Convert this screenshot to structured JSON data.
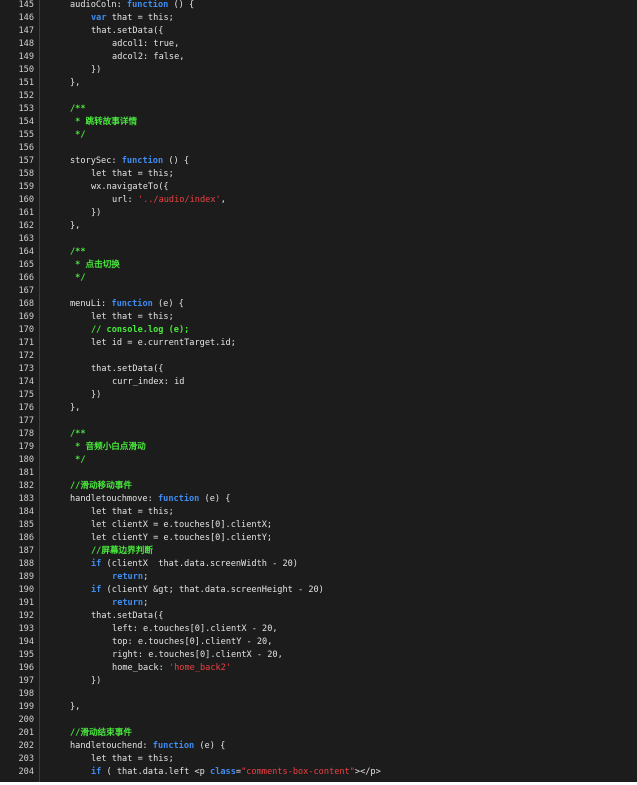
{
  "editor": {
    "colors": {
      "background": "#1c1c1c",
      "text": "#e3e3e3",
      "keyword": "#3e8cf0",
      "comment": "#49e83d",
      "string": "#ee4040",
      "line_number": "#cfcfcf"
    },
    "lines": [
      {
        "num": "145",
        "indent": 0,
        "tokens": [
          {
            "t": "audioColn: ",
            "c": "plain"
          },
          {
            "t": "function",
            "c": "kw"
          },
          {
            "t": " () {",
            "c": "plain"
          }
        ]
      },
      {
        "num": "146",
        "indent": 2,
        "tokens": [
          {
            "t": "var",
            "c": "kw"
          },
          {
            "t": " that = this;",
            "c": "plain"
          }
        ]
      },
      {
        "num": "147",
        "indent": 2,
        "tokens": [
          {
            "t": "that.setData({",
            "c": "plain"
          }
        ]
      },
      {
        "num": "148",
        "indent": 4,
        "tokens": [
          {
            "t": "adcol1: true,",
            "c": "plain"
          }
        ]
      },
      {
        "num": "149",
        "indent": 4,
        "tokens": [
          {
            "t": "adcol2: false,",
            "c": "plain"
          }
        ]
      },
      {
        "num": "150",
        "indent": 2,
        "tokens": [
          {
            "t": "})",
            "c": "plain"
          }
        ]
      },
      {
        "num": "151",
        "indent": 0,
        "tokens": [
          {
            "t": "},",
            "c": "plain"
          }
        ]
      },
      {
        "num": "152",
        "indent": 0,
        "tokens": []
      },
      {
        "num": "153",
        "indent": 0,
        "tokens": [
          {
            "t": "/**",
            "c": "cm"
          }
        ]
      },
      {
        "num": "154",
        "indent": 0,
        "tokens": [
          {
            "t": " * 跳转故事详情",
            "c": "cm"
          }
        ]
      },
      {
        "num": "155",
        "indent": 0,
        "tokens": [
          {
            "t": " */",
            "c": "cm"
          }
        ]
      },
      {
        "num": "156",
        "indent": 0,
        "tokens": []
      },
      {
        "num": "157",
        "indent": 0,
        "tokens": [
          {
            "t": "storySec: ",
            "c": "plain"
          },
          {
            "t": "function",
            "c": "kw"
          },
          {
            "t": " () {",
            "c": "plain"
          }
        ]
      },
      {
        "num": "158",
        "indent": 2,
        "tokens": [
          {
            "t": "let that = this;",
            "c": "plain"
          }
        ]
      },
      {
        "num": "159",
        "indent": 2,
        "tokens": [
          {
            "t": "wx.navigateTo({",
            "c": "plain"
          }
        ]
      },
      {
        "num": "160",
        "indent": 4,
        "tokens": [
          {
            "t": "url: ",
            "c": "plain"
          },
          {
            "t": "'../audio/index'",
            "c": "str"
          },
          {
            "t": ",",
            "c": "plain"
          }
        ]
      },
      {
        "num": "161",
        "indent": 2,
        "tokens": [
          {
            "t": "})",
            "c": "plain"
          }
        ]
      },
      {
        "num": "162",
        "indent": 0,
        "tokens": [
          {
            "t": "},",
            "c": "plain"
          }
        ]
      },
      {
        "num": "163",
        "indent": 0,
        "tokens": []
      },
      {
        "num": "164",
        "indent": 0,
        "tokens": [
          {
            "t": "/**",
            "c": "cm"
          }
        ]
      },
      {
        "num": "165",
        "indent": 0,
        "tokens": [
          {
            "t": " * 点击切换",
            "c": "cm"
          }
        ]
      },
      {
        "num": "166",
        "indent": 0,
        "tokens": [
          {
            "t": " */",
            "c": "cm"
          }
        ]
      },
      {
        "num": "167",
        "indent": 0,
        "tokens": []
      },
      {
        "num": "168",
        "indent": 0,
        "tokens": [
          {
            "t": "menuLi: ",
            "c": "plain"
          },
          {
            "t": "function",
            "c": "kw"
          },
          {
            "t": " (e) {",
            "c": "plain"
          }
        ]
      },
      {
        "num": "169",
        "indent": 2,
        "tokens": [
          {
            "t": "let that = this;",
            "c": "plain"
          }
        ]
      },
      {
        "num": "170",
        "indent": 2,
        "tokens": [
          {
            "t": "// console.log (e);",
            "c": "cm"
          }
        ]
      },
      {
        "num": "171",
        "indent": 2,
        "tokens": [
          {
            "t": "let id = e.currentTarget.id;",
            "c": "plain"
          }
        ]
      },
      {
        "num": "172",
        "indent": 0,
        "tokens": []
      },
      {
        "num": "173",
        "indent": 2,
        "tokens": [
          {
            "t": "that.setData({",
            "c": "plain"
          }
        ]
      },
      {
        "num": "174",
        "indent": 4,
        "tokens": [
          {
            "t": "curr_index: id",
            "c": "plain"
          }
        ]
      },
      {
        "num": "175",
        "indent": 2,
        "tokens": [
          {
            "t": "})",
            "c": "plain"
          }
        ]
      },
      {
        "num": "176",
        "indent": 0,
        "tokens": [
          {
            "t": "},",
            "c": "plain"
          }
        ]
      },
      {
        "num": "177",
        "indent": 0,
        "tokens": []
      },
      {
        "num": "178",
        "indent": 0,
        "tokens": [
          {
            "t": "/**",
            "c": "cm"
          }
        ]
      },
      {
        "num": "179",
        "indent": 0,
        "tokens": [
          {
            "t": " * 音频小白点滑动",
            "c": "cm"
          }
        ]
      },
      {
        "num": "180",
        "indent": 0,
        "tokens": [
          {
            "t": " */",
            "c": "cm"
          }
        ]
      },
      {
        "num": "181",
        "indent": 0,
        "tokens": []
      },
      {
        "num": "182",
        "indent": 0,
        "tokens": [
          {
            "t": "//滑动移动事件",
            "c": "cm"
          }
        ]
      },
      {
        "num": "183",
        "indent": 0,
        "tokens": [
          {
            "t": "handletouchmove: ",
            "c": "plain"
          },
          {
            "t": "function",
            "c": "kw"
          },
          {
            "t": " (e) {",
            "c": "plain"
          }
        ]
      },
      {
        "num": "184",
        "indent": 2,
        "tokens": [
          {
            "t": "let that = this;",
            "c": "plain"
          }
        ]
      },
      {
        "num": "185",
        "indent": 2,
        "tokens": [
          {
            "t": "let clientX = e.touches[0].clientX;",
            "c": "plain"
          }
        ]
      },
      {
        "num": "186",
        "indent": 2,
        "tokens": [
          {
            "t": "let clientY = e.touches[0].clientY;",
            "c": "plain"
          }
        ]
      },
      {
        "num": "187",
        "indent": 2,
        "tokens": [
          {
            "t": "//屏幕边界判断",
            "c": "cm"
          }
        ]
      },
      {
        "num": "188",
        "indent": 2,
        "tokens": [
          {
            "t": "if",
            "c": "kw"
          },
          {
            "t": " (clientX  that.data.screenWidth - 20)",
            "c": "plain"
          }
        ]
      },
      {
        "num": "189",
        "indent": 4,
        "tokens": [
          {
            "t": "return",
            "c": "kw"
          },
          {
            "t": ";",
            "c": "plain"
          }
        ]
      },
      {
        "num": "190",
        "indent": 2,
        "tokens": [
          {
            "t": "if",
            "c": "kw"
          },
          {
            "t": " (clientY &gt; that.data.screenHeight - 20)",
            "c": "plain"
          }
        ]
      },
      {
        "num": "191",
        "indent": 4,
        "tokens": [
          {
            "t": "return",
            "c": "kw"
          },
          {
            "t": ";",
            "c": "plain"
          }
        ]
      },
      {
        "num": "192",
        "indent": 2,
        "tokens": [
          {
            "t": "that.setData({",
            "c": "plain"
          }
        ]
      },
      {
        "num": "193",
        "indent": 4,
        "tokens": [
          {
            "t": "left: e.touches[0].clientX - 20,",
            "c": "plain"
          }
        ]
      },
      {
        "num": "194",
        "indent": 4,
        "tokens": [
          {
            "t": "top: e.touches[0].clientY - 20,",
            "c": "plain"
          }
        ]
      },
      {
        "num": "195",
        "indent": 4,
        "tokens": [
          {
            "t": "right: e.touches[0].clientX - 20,",
            "c": "plain"
          }
        ]
      },
      {
        "num": "196",
        "indent": 4,
        "tokens": [
          {
            "t": "home_back: ",
            "c": "plain"
          },
          {
            "t": "'home_back2'",
            "c": "str"
          }
        ]
      },
      {
        "num": "197",
        "indent": 2,
        "tokens": [
          {
            "t": "})",
            "c": "plain"
          }
        ]
      },
      {
        "num": "198",
        "indent": 0,
        "tokens": []
      },
      {
        "num": "199",
        "indent": 0,
        "tokens": [
          {
            "t": "},",
            "c": "plain"
          }
        ]
      },
      {
        "num": "200",
        "indent": 0,
        "tokens": []
      },
      {
        "num": "201",
        "indent": 0,
        "tokens": [
          {
            "t": "//滑动结束事件",
            "c": "cm"
          }
        ]
      },
      {
        "num": "202",
        "indent": 0,
        "tokens": [
          {
            "t": "handletouchend: ",
            "c": "plain"
          },
          {
            "t": "function",
            "c": "kw"
          },
          {
            "t": " (e) {",
            "c": "plain"
          }
        ]
      },
      {
        "num": "203",
        "indent": 2,
        "tokens": [
          {
            "t": "let that = this;",
            "c": "plain"
          }
        ]
      },
      {
        "num": "204",
        "indent": 2,
        "tokens": [
          {
            "t": "if",
            "c": "kw"
          },
          {
            "t": " ( that.data.left <p ",
            "c": "plain"
          },
          {
            "t": "class",
            "c": "kw"
          },
          {
            "t": "=",
            "c": "plain"
          },
          {
            "t": "\"comments-box-content\"",
            "c": "str"
          },
          {
            "t": "></p>",
            "c": "plain"
          }
        ]
      }
    ]
  }
}
